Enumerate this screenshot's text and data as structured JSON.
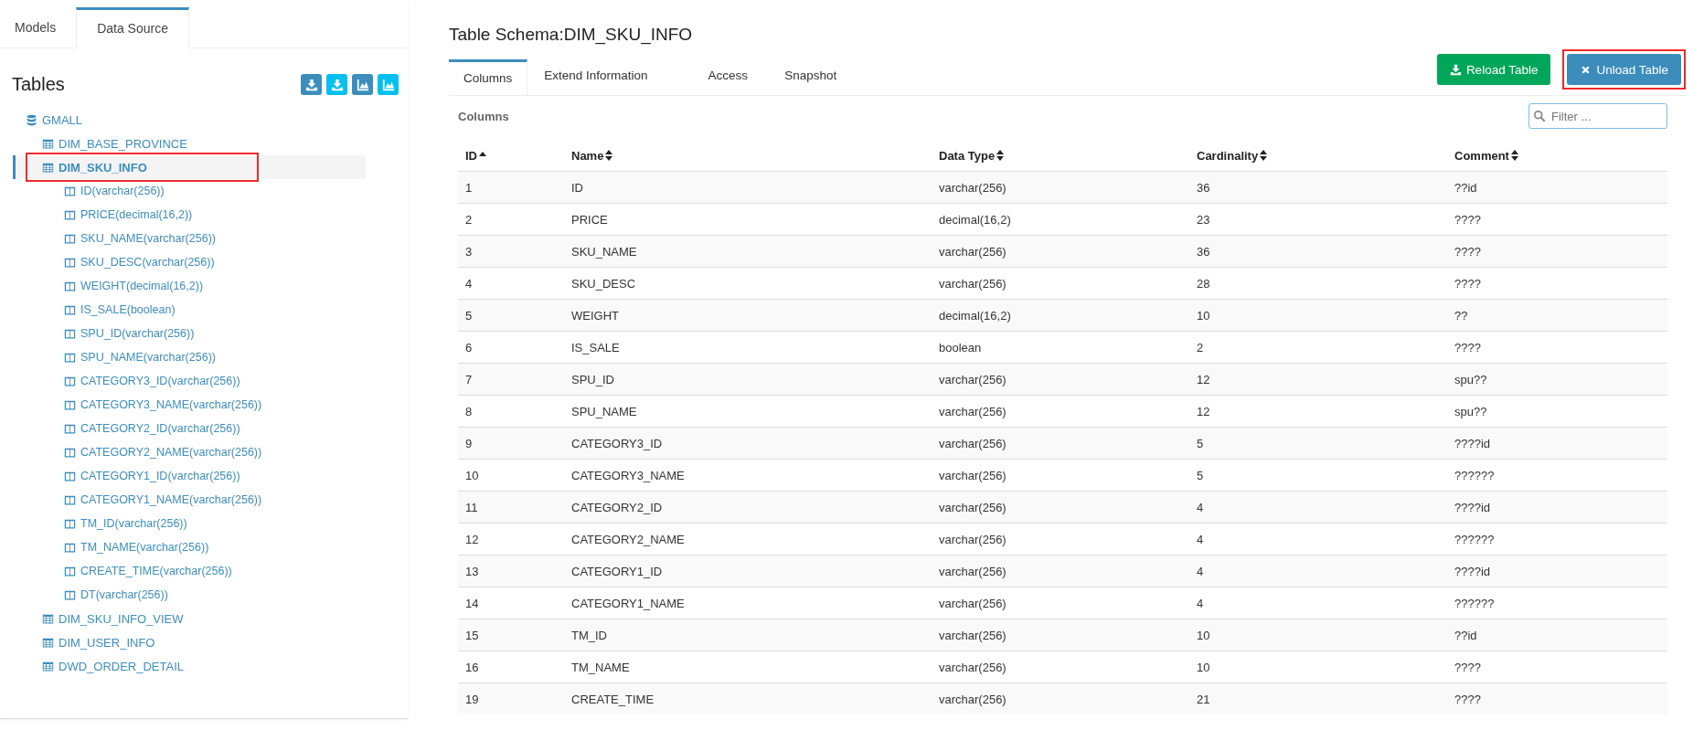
{
  "left_tabs": [
    {
      "label": "Models",
      "selected": false
    },
    {
      "label": "Data Source",
      "selected": true
    }
  ],
  "tables_panel": {
    "title": "Tables",
    "tools": [
      {
        "kind": "download",
        "color": "#3c8dbc"
      },
      {
        "kind": "download",
        "color": "#00c0ef"
      },
      {
        "kind": "chart",
        "color": "#3c8dbc"
      },
      {
        "kind": "chart",
        "color": "#00c0ef"
      }
    ],
    "tree": [
      {
        "label": "GMALL",
        "kind": "database",
        "children": [
          {
            "label": "DIM_BASE_PROVINCE",
            "kind": "table",
            "selected": false,
            "highlighted": false
          },
          {
            "label": "DIM_SKU_INFO",
            "kind": "table",
            "selected": true,
            "highlighted": true,
            "children": [
              {
                "label": "ID(varchar(256))",
                "kind": "column"
              },
              {
                "label": "PRICE(decimal(16,2))",
                "kind": "column"
              },
              {
                "label": "SKU_NAME(varchar(256))",
                "kind": "column"
              },
              {
                "label": "SKU_DESC(varchar(256))",
                "kind": "column"
              },
              {
                "label": "WEIGHT(decimal(16,2))",
                "kind": "column"
              },
              {
                "label": "IS_SALE(boolean)",
                "kind": "column"
              },
              {
                "label": "SPU_ID(varchar(256))",
                "kind": "column"
              },
              {
                "label": "SPU_NAME(varchar(256))",
                "kind": "column"
              },
              {
                "label": "CATEGORY3_ID(varchar(256))",
                "kind": "column"
              },
              {
                "label": "CATEGORY3_NAME(varchar(256))",
                "kind": "column"
              },
              {
                "label": "CATEGORY2_ID(varchar(256))",
                "kind": "column"
              },
              {
                "label": "CATEGORY2_NAME(varchar(256))",
                "kind": "column"
              },
              {
                "label": "CATEGORY1_ID(varchar(256))",
                "kind": "column"
              },
              {
                "label": "CATEGORY1_NAME(varchar(256))",
                "kind": "column"
              },
              {
                "label": "TM_ID(varchar(256))",
                "kind": "column"
              },
              {
                "label": "TM_NAME(varchar(256))",
                "kind": "column"
              },
              {
                "label": "CREATE_TIME(varchar(256))",
                "kind": "column"
              },
              {
                "label": "DT(varchar(256))",
                "kind": "column"
              }
            ]
          },
          {
            "label": "DIM_SKU_INFO_VIEW",
            "kind": "table",
            "selected": false,
            "highlighted": false
          },
          {
            "label": "DIM_USER_INFO",
            "kind": "table",
            "selected": false,
            "highlighted": false
          },
          {
            "label": "DWD_ORDER_DETAIL",
            "kind": "table",
            "selected": false,
            "highlighted": false
          }
        ]
      }
    ]
  },
  "schema": {
    "title": "Table Schema:DIM_SKU_INFO",
    "tabs": [
      {
        "label": "Columns",
        "selected": true
      },
      {
        "label": "Extend Information",
        "selected": false
      },
      {
        "label": "Access",
        "selected": false
      },
      {
        "label": "Snapshot",
        "selected": false
      }
    ],
    "buttons": [
      {
        "label": "Reload Table",
        "kind": "reload",
        "highlighted": false
      },
      {
        "label": "Unload Table",
        "kind": "unload",
        "highlighted": true
      }
    ],
    "section_title": "Columns",
    "filter": {
      "placeholder": "Filter ..."
    },
    "table": {
      "columns": [
        {
          "label": "ID",
          "sorted_ascending": true
        },
        {
          "label": "Name",
          "sorted_ascending": false
        },
        {
          "label": "Data Type",
          "sorted_ascending": false
        },
        {
          "label": "Cardinality",
          "sorted_ascending": false
        },
        {
          "label": "Comment",
          "sorted_ascending": false
        }
      ],
      "rows": [
        [
          "1",
          "ID",
          "varchar(256)",
          "36",
          "??id"
        ],
        [
          "2",
          "PRICE",
          "decimal(16,2)",
          "23",
          "????"
        ],
        [
          "3",
          "SKU_NAME",
          "varchar(256)",
          "36",
          "????"
        ],
        [
          "4",
          "SKU_DESC",
          "varchar(256)",
          "28",
          "????"
        ],
        [
          "5",
          "WEIGHT",
          "decimal(16,2)",
          "10",
          "??"
        ],
        [
          "6",
          "IS_SALE",
          "boolean",
          "2",
          "????"
        ],
        [
          "7",
          "SPU_ID",
          "varchar(256)",
          "12",
          "spu??"
        ],
        [
          "8",
          "SPU_NAME",
          "varchar(256)",
          "12",
          "spu??"
        ],
        [
          "9",
          "CATEGORY3_ID",
          "varchar(256)",
          "5",
          "????id"
        ],
        [
          "10",
          "CATEGORY3_NAME",
          "varchar(256)",
          "5",
          "??????"
        ],
        [
          "11",
          "CATEGORY2_ID",
          "varchar(256)",
          "4",
          "????id"
        ],
        [
          "12",
          "CATEGORY2_NAME",
          "varchar(256)",
          "4",
          "??????"
        ],
        [
          "13",
          "CATEGORY1_ID",
          "varchar(256)",
          "4",
          "????id"
        ],
        [
          "14",
          "CATEGORY1_NAME",
          "varchar(256)",
          "4",
          "??????"
        ],
        [
          "15",
          "TM_ID",
          "varchar(256)",
          "10",
          "??id"
        ],
        [
          "16",
          "TM_NAME",
          "varchar(256)",
          "10",
          "????"
        ],
        [
          "19",
          "CREATE_TIME",
          "varchar(256)",
          "21",
          "????"
        ]
      ]
    }
  }
}
